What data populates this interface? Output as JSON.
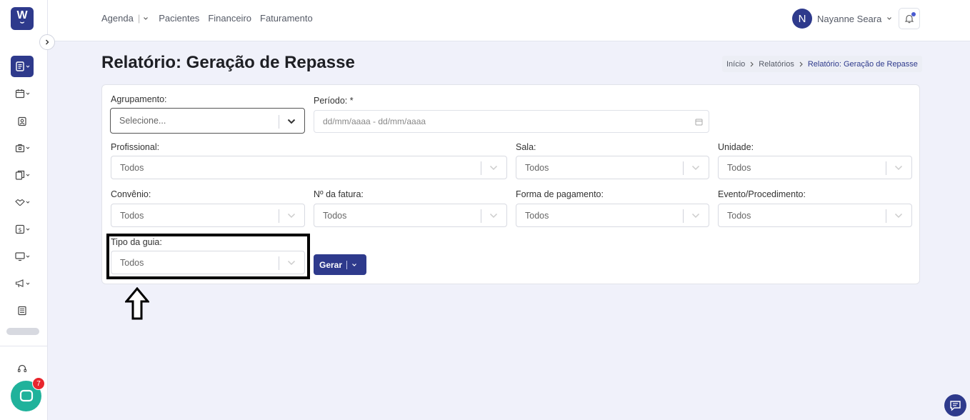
{
  "app": {
    "logo_text": "W",
    "chat_badge_count": "7",
    "accent_color": "#2e3a8c",
    "chat_color": "#20b29b"
  },
  "topnav": {
    "agenda": "Agenda",
    "pacientes": "Pacientes",
    "financeiro": "Financeiro",
    "faturamento": "Faturamento"
  },
  "user": {
    "initial": "N",
    "name": "Nayanne Seara"
  },
  "page": {
    "title": "Relatório: Geração de Repasse"
  },
  "breadcrumb": {
    "inicio": "Início",
    "relatorios": "Relatórios",
    "current": "Relatório: Geração de Repasse"
  },
  "form": {
    "agrupamento": {
      "label": "Agrupamento:",
      "value": "Selecione..."
    },
    "periodo": {
      "label": "Período: *",
      "placeholder": "dd/mm/aaaa - dd/mm/aaaa"
    },
    "profissional": {
      "label": "Profissional:",
      "value": "Todos"
    },
    "sala": {
      "label": "Sala:",
      "value": "Todos"
    },
    "unidade": {
      "label": "Unidade:",
      "value": "Todos"
    },
    "convenio": {
      "label": "Convênio:",
      "value": "Todos"
    },
    "fatura": {
      "label": "Nº da fatura:",
      "value": "Todos"
    },
    "forma_pagamento": {
      "label": "Forma de pagamento:",
      "value": "Todos"
    },
    "evento": {
      "label": "Evento/Procedimento:",
      "value": "Todos"
    },
    "tipo_guia": {
      "label": "Tipo da guia:",
      "value": "Todos"
    },
    "gerar_label": "Gerar"
  },
  "sidebar_icons": [
    "report-icon",
    "calendar-icon",
    "patient-icon",
    "briefcase-icon",
    "documents-icon",
    "handshake-icon",
    "finance-icon",
    "monitor-icon",
    "megaphone-icon",
    "newspaper-icon",
    "headset-icon"
  ]
}
